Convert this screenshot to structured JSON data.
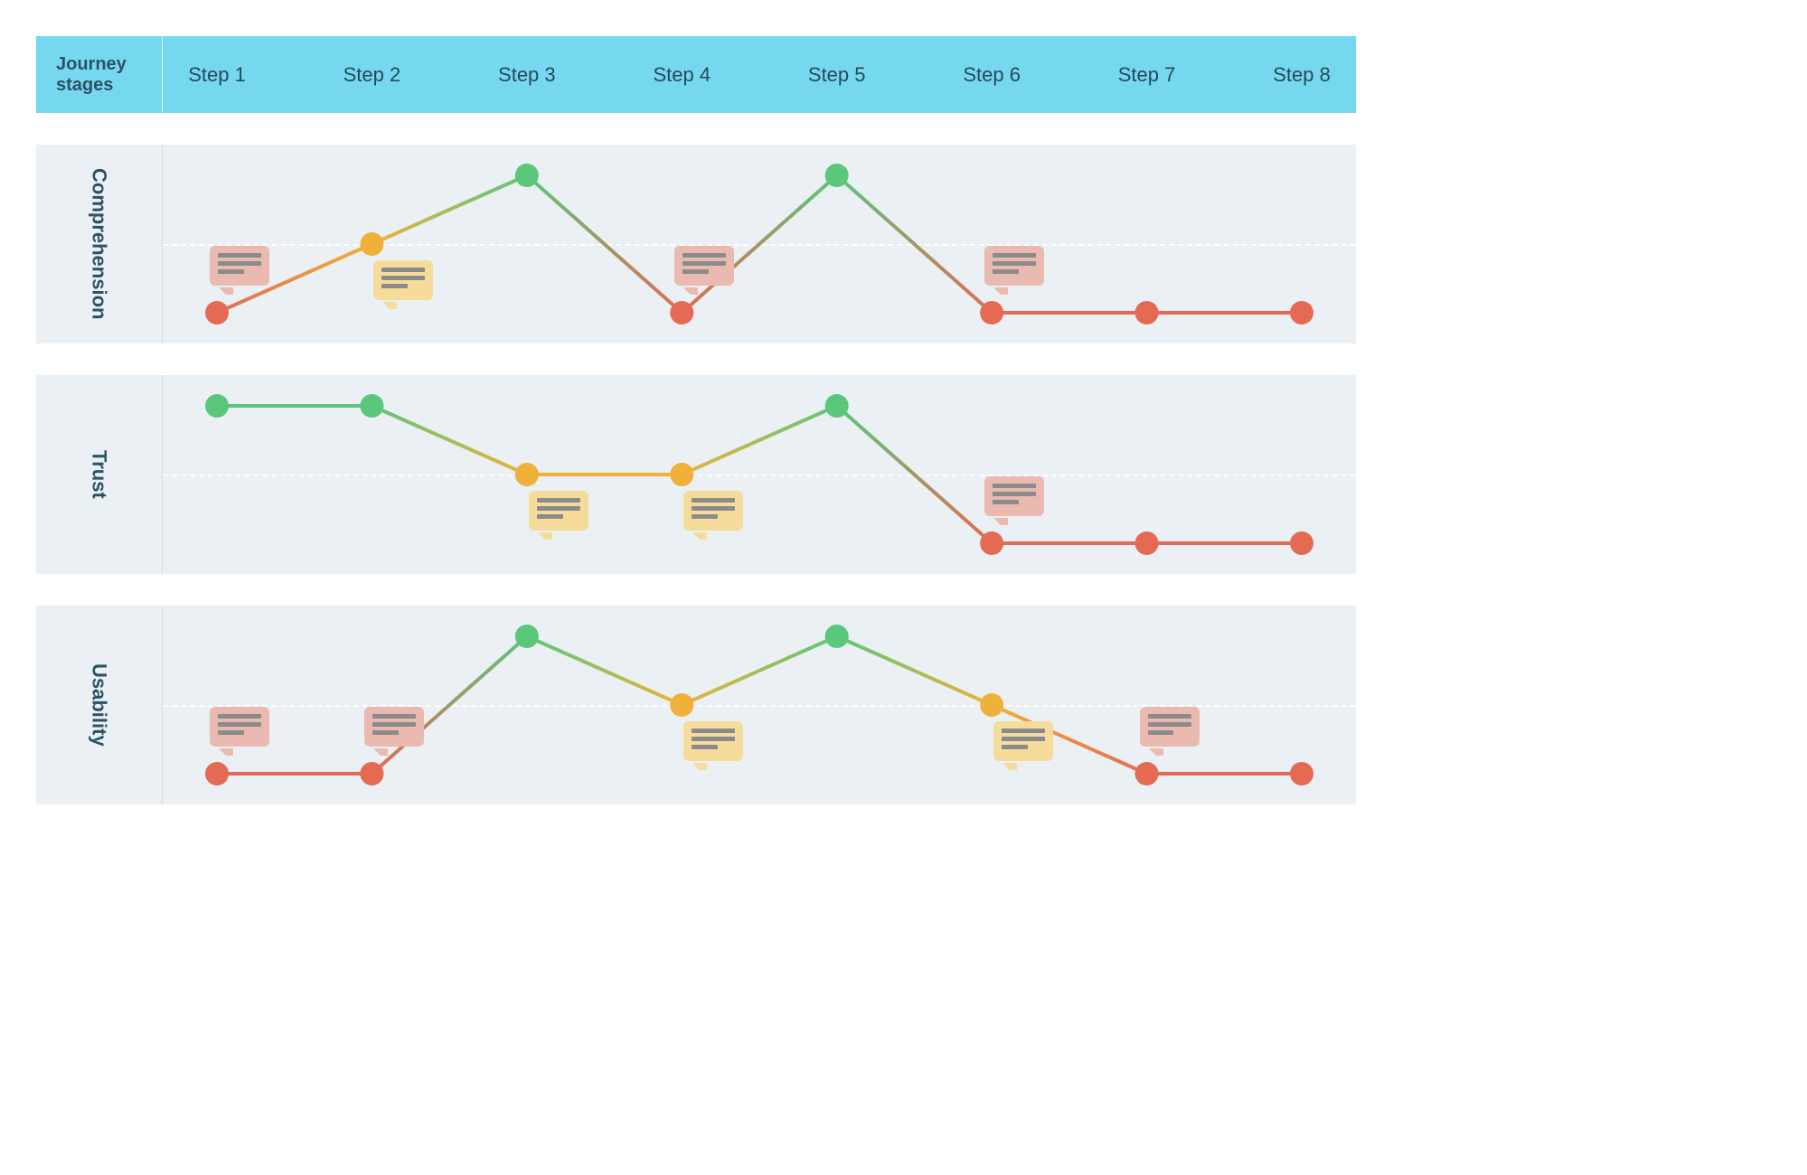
{
  "header": {
    "label": "Journey stages",
    "steps": [
      "Step 1",
      "Step 2",
      "Step 3",
      "Step 4",
      "Step 5",
      "Step 6",
      "Step 7",
      "Step 8"
    ]
  },
  "lanes": [
    {
      "key": "comprehension",
      "label": "Comprehension"
    },
    {
      "key": "trust",
      "label": "Trust"
    },
    {
      "key": "usability",
      "label": "Usability"
    }
  ],
  "colors": {
    "low": "#e56a54",
    "mid": "#f0b13a",
    "high": "#5ac77a",
    "header_bg": "#76d8ef",
    "lane_bg": "#eaf0f3",
    "text": "#2c5266"
  },
  "chart_data": [
    {
      "type": "line",
      "title": "Comprehension",
      "categories": [
        "Step 1",
        "Step 2",
        "Step 3",
        "Step 4",
        "Step 5",
        "Step 6",
        "Step 7",
        "Step 8"
      ],
      "values": [
        1,
        2,
        3,
        1,
        3,
        1,
        1,
        1
      ],
      "ylim": [
        1,
        3
      ],
      "scale_levels": {
        "1": "low",
        "2": "mid",
        "3": "high"
      },
      "annotations": [
        {
          "step": 1,
          "kind": "note",
          "color": "red"
        },
        {
          "step": 2,
          "kind": "note",
          "color": "yellow"
        },
        {
          "step": 4,
          "kind": "note",
          "color": "red"
        },
        {
          "step": 6,
          "kind": "note",
          "color": "red"
        }
      ]
    },
    {
      "type": "line",
      "title": "Trust",
      "categories": [
        "Step 1",
        "Step 2",
        "Step 3",
        "Step 4",
        "Step 5",
        "Step 6",
        "Step 7",
        "Step 8"
      ],
      "values": [
        3,
        3,
        2,
        2,
        3,
        1,
        1,
        1
      ],
      "ylim": [
        1,
        3
      ],
      "scale_levels": {
        "1": "low",
        "2": "mid",
        "3": "high"
      },
      "annotations": [
        {
          "step": 3,
          "kind": "note",
          "color": "yellow"
        },
        {
          "step": 4,
          "kind": "note",
          "color": "yellow"
        },
        {
          "step": 6,
          "kind": "note",
          "color": "red"
        }
      ]
    },
    {
      "type": "line",
      "title": "Usability",
      "categories": [
        "Step 1",
        "Step 2",
        "Step 3",
        "Step 4",
        "Step 5",
        "Step 6",
        "Step 7",
        "Step 8"
      ],
      "values": [
        1,
        1,
        3,
        2,
        3,
        2,
        1,
        1
      ],
      "ylim": [
        1,
        3
      ],
      "scale_levels": {
        "1": "low",
        "2": "mid",
        "3": "high"
      },
      "annotations": [
        {
          "step": 1,
          "kind": "note",
          "color": "red"
        },
        {
          "step": 2,
          "kind": "note",
          "color": "red"
        },
        {
          "step": 4,
          "kind": "note",
          "color": "yellow"
        },
        {
          "step": 6,
          "kind": "note",
          "color": "yellow"
        },
        {
          "step": 7,
          "kind": "note",
          "color": "red"
        }
      ]
    }
  ]
}
